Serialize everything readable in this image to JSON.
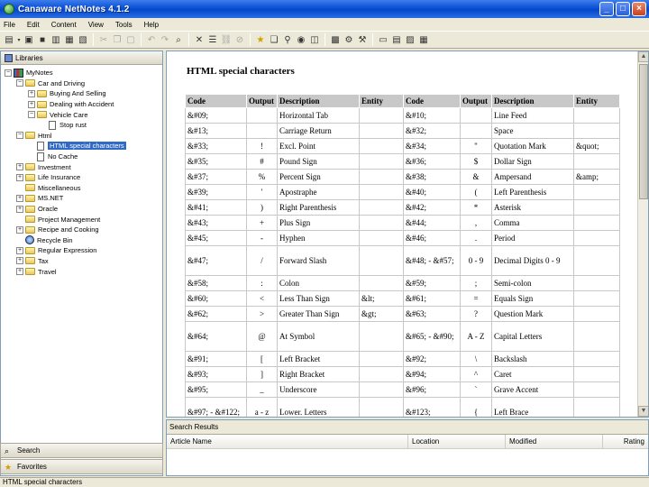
{
  "window": {
    "title": "Canaware NetNotes 4.1.2",
    "minimize": "_",
    "maximize": "□",
    "close": "×"
  },
  "menu": [
    "File",
    "Edit",
    "Content",
    "View",
    "Tools",
    "Help"
  ],
  "left_pane": {
    "header": "Libraries",
    "tree": [
      {
        "label": "MyNotes",
        "depth": 0,
        "type": "library",
        "expander": "−"
      },
      {
        "label": "Car and Driving",
        "depth": 1,
        "type": "folder",
        "expander": "−"
      },
      {
        "label": "Buying And Selling",
        "depth": 2,
        "type": "folder",
        "expander": "+"
      },
      {
        "label": "Dealing with Accident",
        "depth": 2,
        "type": "folder",
        "expander": "+"
      },
      {
        "label": "Vehicle Care",
        "depth": 2,
        "type": "folder",
        "expander": "−"
      },
      {
        "label": "Stop rust",
        "depth": 3,
        "type": "doc",
        "expander": ""
      },
      {
        "label": "Html",
        "depth": 1,
        "type": "folder",
        "expander": "−"
      },
      {
        "label": "HTML special characters",
        "depth": 2,
        "type": "doc",
        "expander": "",
        "selected": true
      },
      {
        "label": "No Cache",
        "depth": 2,
        "type": "doc",
        "expander": ""
      },
      {
        "label": "Investment",
        "depth": 1,
        "type": "folder",
        "expander": "+"
      },
      {
        "label": "Life Insurance",
        "depth": 1,
        "type": "folder",
        "expander": "+"
      },
      {
        "label": "Miscellaneous",
        "depth": 1,
        "type": "folder",
        "expander": ""
      },
      {
        "label": "MS.NET",
        "depth": 1,
        "type": "folder",
        "expander": "+"
      },
      {
        "label": "Oracle",
        "depth": 1,
        "type": "folder",
        "expander": "+"
      },
      {
        "label": "Project Management",
        "depth": 1,
        "type": "folder",
        "expander": ""
      },
      {
        "label": "Recipe and Cooking",
        "depth": 1,
        "type": "folder",
        "expander": "+"
      },
      {
        "label": "Recycle Bin",
        "depth": 1,
        "type": "bin",
        "expander": ""
      },
      {
        "label": "Regular Expression",
        "depth": 1,
        "type": "folder",
        "expander": "+"
      },
      {
        "label": "Tax",
        "depth": 1,
        "type": "folder",
        "expander": "+"
      },
      {
        "label": "Travel",
        "depth": 1,
        "type": "folder",
        "expander": "+"
      }
    ],
    "search_button": "Search",
    "favorites_button": "Favorites"
  },
  "document": {
    "title": "HTML special characters",
    "headers": [
      "Code",
      "Output",
      "Description",
      "Entity",
      "Code",
      "Output",
      "Description",
      "Entity"
    ],
    "rows": [
      [
        "&#09;",
        "",
        "Horizontal Tab",
        "",
        "&#10;",
        "",
        "Line Feed",
        ""
      ],
      [
        "&#13;",
        "",
        "Carriage Return",
        "",
        "&#32;",
        "",
        "Space",
        ""
      ],
      [
        "&#33;",
        "!",
        "Excl. Point",
        "",
        "&#34;",
        "\"",
        "Quotation Mark",
        "&quot;"
      ],
      [
        "&#35;",
        "#",
        "Pound Sign",
        "",
        "&#36;",
        "$",
        "Dollar Sign",
        ""
      ],
      [
        "&#37;",
        "%",
        "Percent Sign",
        "",
        "&#38;",
        "&",
        "Ampersand",
        "&amp;"
      ],
      [
        "&#39;",
        "'",
        "Apostraphe",
        "",
        "&#40;",
        "(",
        "Left Parenthesis",
        ""
      ],
      [
        "&#41;",
        ")",
        "Right Parenthesis",
        "",
        "&#42;",
        "*",
        "Asterisk",
        ""
      ],
      [
        "&#43;",
        "+",
        "Plus Sign",
        "",
        "&#44;",
        ",",
        "Comma",
        ""
      ],
      [
        "&#45;",
        "-",
        "Hyphen",
        "",
        "&#46;",
        ".",
        "Period",
        ""
      ],
      [
        "&#47;",
        "/",
        "Forward Slash",
        "",
        "&#48; - &#57;",
        "0 - 9",
        "Decimal Digits 0 - 9",
        ""
      ],
      [
        "&#58;",
        ":",
        "Colon",
        "",
        "&#59;",
        ";",
        "Semi-colon",
        ""
      ],
      [
        "&#60;",
        "<",
        "Less Than Sign",
        "&lt;",
        "&#61;",
        "=",
        "Equals Sign",
        ""
      ],
      [
        "&#62;",
        ">",
        "Greater Than Sign",
        "&gt;",
        "&#63;",
        "?",
        "Question Mark",
        ""
      ],
      [
        "&#64;",
        "@",
        "At Symbol",
        "",
        "&#65; - &#90;",
        "A - Z",
        "Capital Letters",
        ""
      ],
      [
        "&#91;",
        "[",
        "Left Bracket",
        "",
        "&#92;",
        "\\",
        "Backslash",
        ""
      ],
      [
        "&#93;",
        "]",
        "Right Bracket",
        "",
        "&#94;",
        "^",
        "Caret",
        ""
      ],
      [
        "&#95;",
        "_",
        "Underscore",
        "",
        "&#96;",
        "`",
        "Grave Accent",
        ""
      ],
      [
        "&#97; - &#122;",
        "a - z",
        "Lower. Letters",
        "",
        "&#123;",
        "{",
        "Left Brace",
        ""
      ]
    ]
  },
  "search_results": {
    "title": "Search Results",
    "columns": [
      "Article Name",
      "Location",
      "Modified",
      "Rating"
    ]
  },
  "status": "HTML special characters"
}
